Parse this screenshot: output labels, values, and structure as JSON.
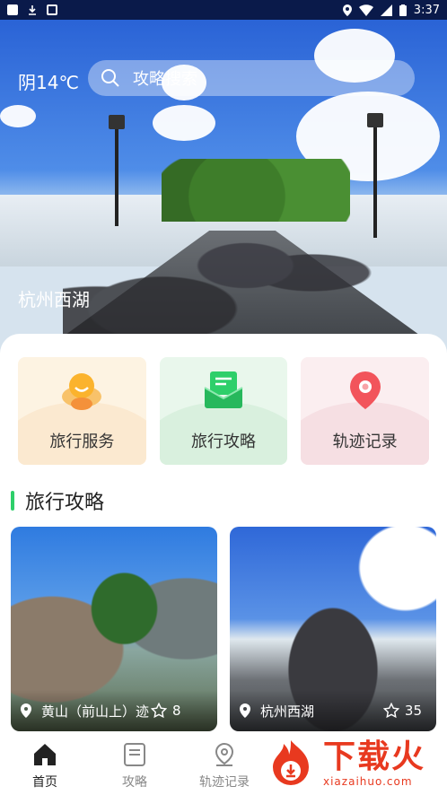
{
  "status_bar": {
    "time": "3:37"
  },
  "hero": {
    "weather": "阴14℃",
    "search_placeholder": "攻略搜索",
    "location_label": "杭州西湖"
  },
  "services": [
    {
      "label": "旅行服务",
      "icon": "person-service-icon"
    },
    {
      "label": "旅行攻略",
      "icon": "guide-mail-icon"
    },
    {
      "label": "轨迹记录",
      "icon": "location-pin-icon"
    }
  ],
  "section": {
    "title": "旅行攻略"
  },
  "cards": [
    {
      "place": "黄山（前山上）迹",
      "stars": "8"
    },
    {
      "place": "杭州西湖",
      "stars": "35"
    }
  ],
  "bottom_nav": [
    {
      "label": "首页",
      "icon": "home-icon",
      "active": true
    },
    {
      "label": "攻略",
      "icon": "book-icon",
      "active": false
    },
    {
      "label": "轨迹记录",
      "icon": "track-pin-icon",
      "active": false
    }
  ],
  "watermark": {
    "text": "下载火",
    "subtext": "xiazaihuo.com"
  },
  "colors": {
    "accent_green": "#2ecf6a",
    "watermark_red": "#e8391f",
    "status_bar": "#0a1a4a"
  }
}
